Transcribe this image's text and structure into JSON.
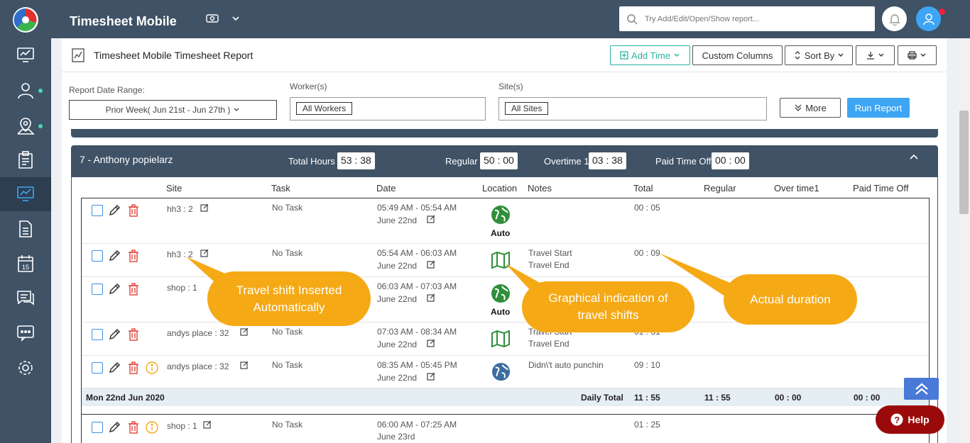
{
  "app": {
    "title": "Timesheet Mobile"
  },
  "search": {
    "placeholder": "Try Add/Edit/Open/Show report..."
  },
  "report": {
    "title": "Timesheet Mobile Timesheet Report"
  },
  "toolbar": {
    "add_time": "Add Time",
    "custom_columns": "Custom Columns",
    "sort_by": "Sort By"
  },
  "filters": {
    "date_label": "Report Date Range:",
    "date_value": "Prior Week( Jun 21st - Jun 27th )",
    "workers_label": "Worker(s)",
    "workers_chip": "All Workers",
    "sites_label": "Site(s)",
    "sites_chip": "All Sites",
    "more": "More",
    "run": "Run Report"
  },
  "employee": {
    "name": "7 - Anthony popielarz",
    "total_hours_label": "Total Hours",
    "total_hours": "53 : 38",
    "regular_label": "Regular",
    "regular": "50 : 00",
    "overtime_label": "Overtime 1",
    "overtime": "03 : 38",
    "pto_label": "Paid Time Off",
    "pto": "00 : 00"
  },
  "columns": [
    "Site",
    "Task",
    "Date",
    "Location",
    "Notes",
    "Total",
    "Regular",
    "Over time1",
    "Paid Time Off"
  ],
  "rows": [
    {
      "site": "hh3 : 2",
      "task": "No Task",
      "time": "05:49 AM - 05:54 AM",
      "date": "June 22nd",
      "location": "globe",
      "loc_label": "Auto",
      "notes1": "",
      "notes2": "",
      "total": "00 : 05",
      "warn": false
    },
    {
      "site": "hh3 : 2",
      "task": "No Task",
      "time": "05:54 AM - 06:03 AM",
      "date": "June 22nd",
      "location": "map",
      "loc_label": "",
      "notes1": "Travel Start",
      "notes2": "Travel End",
      "total": "00 : 09",
      "warn": false
    },
    {
      "site": "shop : 1",
      "task": "",
      "time": "06:03 AM - 07:03 AM",
      "date": "June 22nd",
      "location": "globe",
      "loc_label": "Auto",
      "notes1": "",
      "notes2": "",
      "total": "",
      "warn": false
    },
    {
      "site": "andys place : 32",
      "task": "No Task",
      "time": "07:03 AM - 08:34 AM",
      "date": "June 22nd",
      "location": "map",
      "loc_label": "",
      "notes1": "Travel Start",
      "notes2": "Travel End",
      "total": "01 : 31",
      "warn": false
    },
    {
      "site": "andys place : 32",
      "task": "No Task",
      "time": "08:35 AM - 05:45 PM",
      "date": "June 22nd",
      "location": "globe-blue",
      "loc_label": "",
      "notes1": "Didn\\'t auto punchin",
      "notes2": "",
      "total": "09 : 10",
      "warn": true
    }
  ],
  "daily": {
    "day": "Mon 22nd Jun 2020",
    "label": "Daily Total",
    "total": "11 : 55",
    "regular": "11 : 55",
    "overtime": "00 : 00",
    "pto": "00 : 00"
  },
  "next_row": {
    "site": "shop : 1",
    "task": "No Task",
    "time": "06:00 AM - 07:25 AM",
    "date": "June 23rd",
    "total": "01 : 25"
  },
  "callouts": {
    "travel": "Travel shift Inserted Automatically",
    "graphical": "Graphical indication of travel shifts",
    "duration": "Actual duration"
  },
  "help": "Help",
  "colors": {
    "sidebar": "#3f5266",
    "accent": "#3da5f4",
    "callout": "#f5a915",
    "help": "#9b0a0a"
  }
}
